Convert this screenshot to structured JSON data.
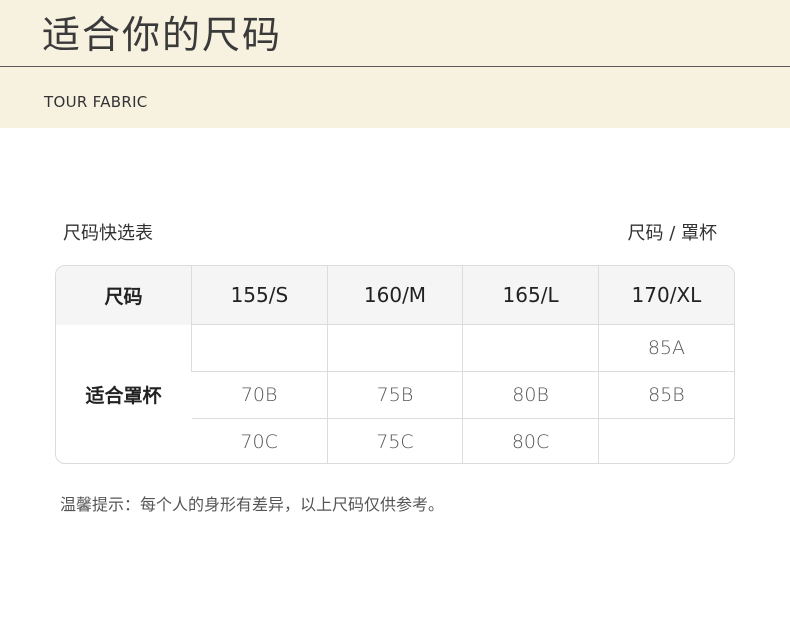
{
  "banner": {
    "title": "适合你的尺码",
    "subtitle": "TOUR FABRIC"
  },
  "table": {
    "caption": "尺码快选表",
    "unit": "尺码 / 罩杯",
    "corner_label": "尺码",
    "row_label": "适合罩杯",
    "columns": [
      "155/S",
      "160/M",
      "165/L",
      "170/XL"
    ],
    "rows": [
      [
        "",
        "",
        "",
        "85A"
      ],
      [
        "70B",
        "75B",
        "80B",
        "85B"
      ],
      [
        "70C",
        "75C",
        "80C",
        ""
      ]
    ]
  },
  "note": "温馨提示：每个人的身形有差异，以上尺码仅供参考。",
  "colors": {
    "banner_bg": "#f7f1e0",
    "header_cell_bg": "#f5f5f5",
    "border": "#dcdcdc"
  }
}
